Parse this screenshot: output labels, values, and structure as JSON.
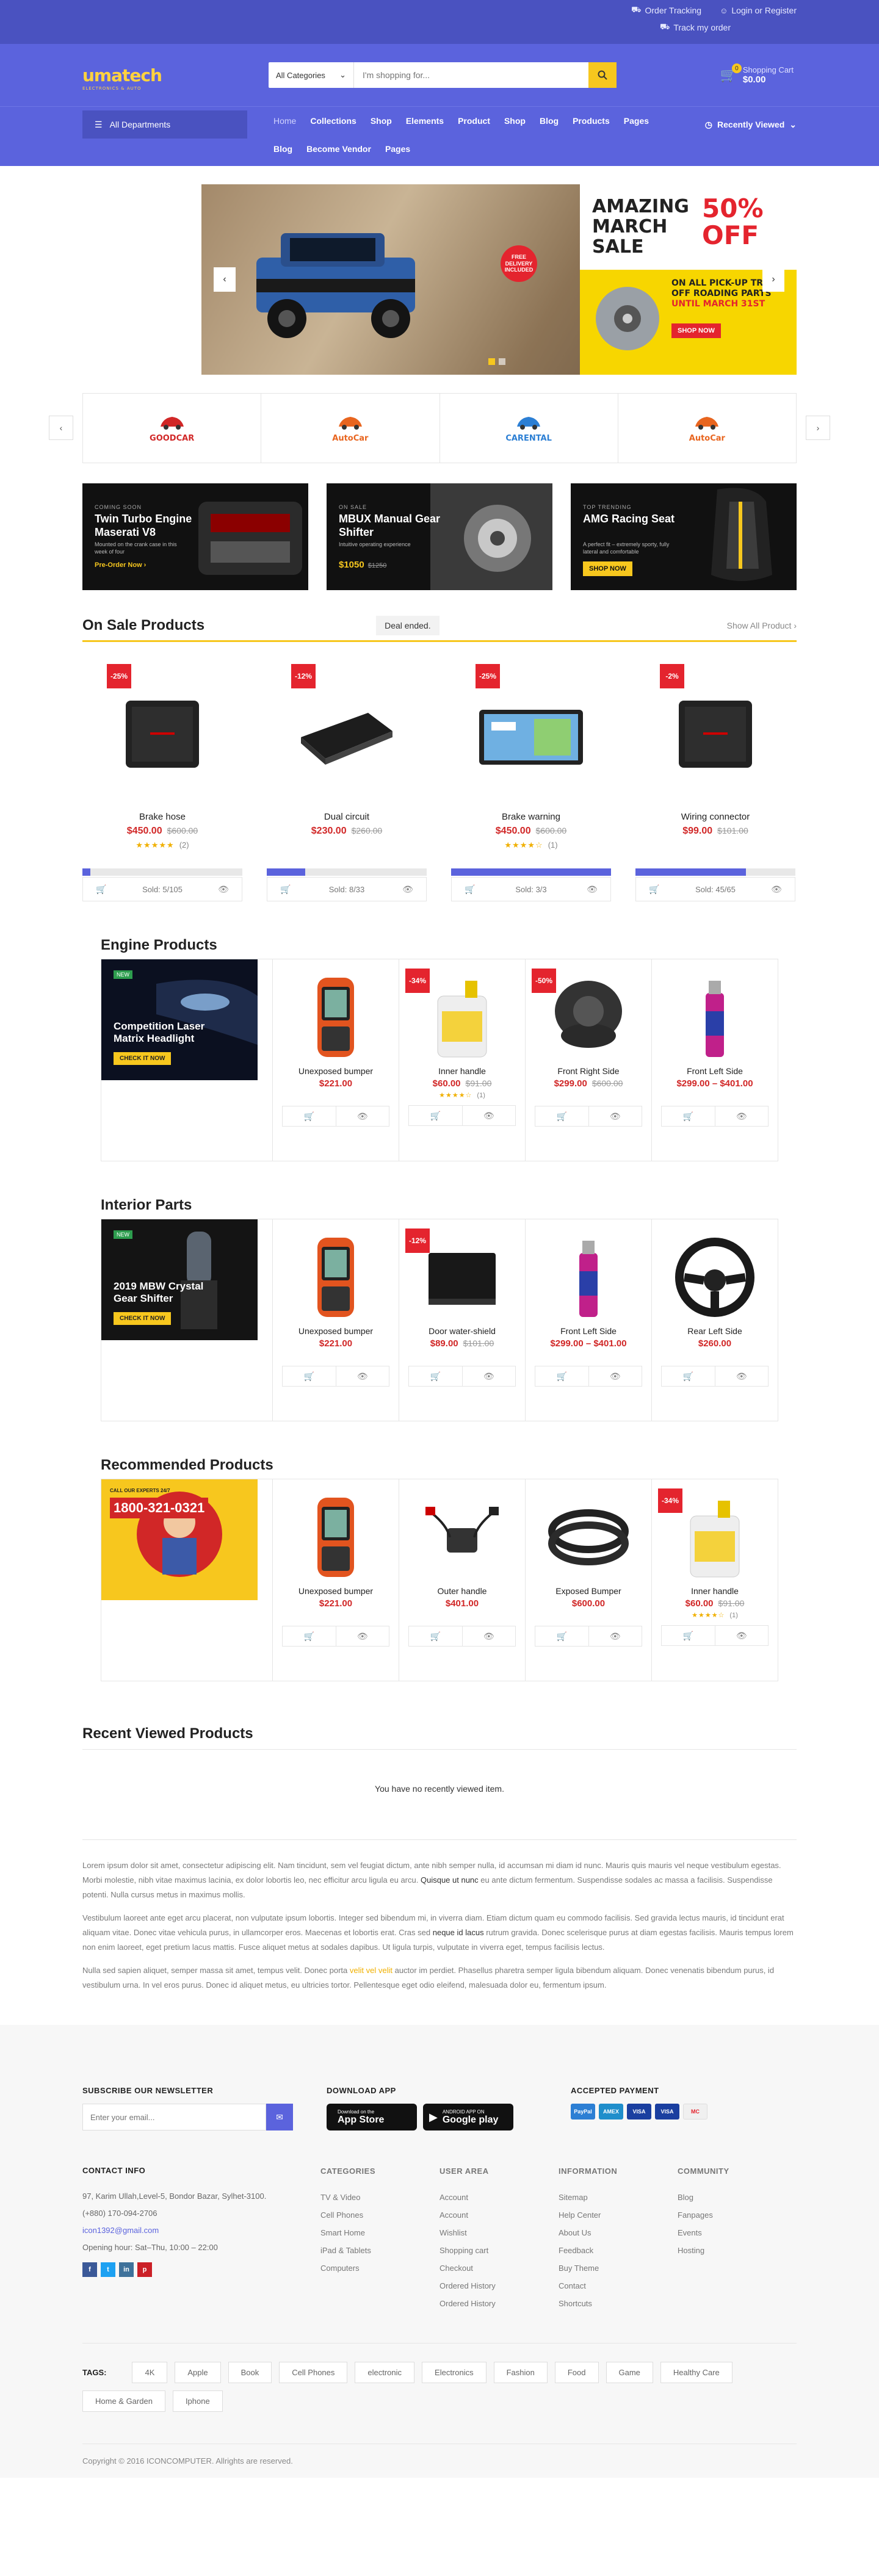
{
  "topbar": {
    "order_tracking": "Order Tracking",
    "login": "Login or Register",
    "track": "Track my order"
  },
  "header": {
    "logo": "umatech",
    "logo_sub": "ELECTRONICS & AUTO",
    "search_category": "All Categories",
    "search_placeholder": "I'm shopping for...",
    "cart_label": "Shopping Cart",
    "cart_total": "$0.00",
    "cart_count": "0"
  },
  "nav": {
    "departments": "All Departments",
    "items": [
      "Home",
      "Collections",
      "Shop",
      "Elements",
      "Product",
      "Shop",
      "Blog",
      "Products",
      "Pages",
      "Blog",
      "Become Vendor",
      "Pages"
    ],
    "recent": "Recently Viewed"
  },
  "hero": {
    "line1": "AMAZING",
    "line2": "MARCH",
    "line3": "SALE",
    "pct": "50%",
    "off": "OFF",
    "sub1": "ON ALL PICK-UP TRUCK",
    "sub2": "OFF ROADING PARTS",
    "sub3": "UNTIL MARCH 31ST",
    "cta": "SHOP NOW",
    "free": "FREE DELIVERY INCLUDED"
  },
  "brands": [
    "GOODCAR",
    "AutoCar",
    "CARENTAL",
    "AutoCar"
  ],
  "brand_colors": [
    "#d12727",
    "#e8651f",
    "#2c7fd4",
    "#e8651f"
  ],
  "promos": [
    {
      "label": "COMING SOON",
      "title": "Twin Turbo Engine Maserati V8",
      "desc": "Mounted on the crank case in this week of four",
      "cta": "Pre-Order Now ›"
    },
    {
      "label": "ON SALE",
      "title": "MBUX Manual Gear Shifter",
      "desc": "Intuitive operating experience",
      "price": "$1050",
      "old": "$1250"
    },
    {
      "label": "TOP TRENDING",
      "title": "AMG Racing Seat",
      "desc": "A perfect fit – extremely sporty, fully lateral and comfortable",
      "cta": "SHOP NOW"
    }
  ],
  "on_sale": {
    "title": "On Sale Products",
    "deal": "Deal ended.",
    "show_all": "Show All Product ›",
    "products": [
      {
        "disc": "-25%",
        "name": "Brake hose",
        "price": "$450.00",
        "old": "$600.00",
        "stars": "★★★★★",
        "count": "(2)",
        "sold": "Sold: 5/105",
        "progress": 0.05
      },
      {
        "disc": "-12%",
        "name": "Dual circuit",
        "price": "$230.00",
        "old": "$260.00",
        "sold": "Sold: 8/33",
        "progress": 0.24
      },
      {
        "disc": "-25%",
        "name": "Brake warning",
        "price": "$450.00",
        "old": "$600.00",
        "stars": "★★★★☆",
        "count": "(1)",
        "sold": "Sold: 3/3",
        "progress": 1.0
      },
      {
        "disc": "-2%",
        "name": "Wiring connector",
        "price": "$99.00",
        "old": "$101.00",
        "sold": "Sold: 45/65",
        "progress": 0.69
      }
    ]
  },
  "sections": [
    {
      "title": "Engine Products",
      "banner": "Competition Laser Matrix Headlight",
      "banner_btn": "CHECK IT NOW",
      "banner_new": "NEW",
      "products": [
        {
          "name": "Unexposed bumper",
          "price": "$221.00"
        },
        {
          "disc": "-34%",
          "name": "Inner handle",
          "price": "$60.00",
          "old": "$91.00",
          "stars": "★★★★☆",
          "count": "(1)"
        },
        {
          "disc": "-50%",
          "name": "Front Right Side",
          "price": "$299.00",
          "old": "$600.00"
        },
        {
          "name": "Front Left Side",
          "price": "$299.00 – $401.00"
        }
      ]
    },
    {
      "title": "Interior Parts",
      "banner": "2019 MBW Crystal Gear Shifter",
      "banner_btn": "CHECK IT NOW",
      "banner_new": "NEW",
      "products": [
        {
          "name": "Unexposed bumper",
          "price": "$221.00"
        },
        {
          "disc": "-12%",
          "name": "Door water-shield",
          "price": "$89.00",
          "old": "$101.00"
        },
        {
          "name": "Front Left Side",
          "price": "$299.00 – $401.00"
        },
        {
          "name": "Rear Left Side",
          "price": "$260.00"
        }
      ]
    },
    {
      "title": "Recommended Products",
      "banner": "1800-321-0321",
      "banner_btn": "",
      "banner_new": "CALL OUR EXPERTS 24/7",
      "products": [
        {
          "name": "Unexposed bumper",
          "price": "$221.00"
        },
        {
          "name": "Outer handle",
          "price": "$401.00"
        },
        {
          "name": "Exposed Bumper",
          "price": "$600.00"
        },
        {
          "disc": "-34%",
          "name": "Inner handle",
          "price": "$60.00",
          "old": "$91.00",
          "stars": "★★★★☆",
          "count": "(1)"
        }
      ]
    }
  ],
  "recent_viewed": {
    "title": "Recent Viewed Products",
    "empty": "You have no recently viewed item."
  },
  "seo": {
    "p1a": "Lorem ipsum dolor sit amet, consectetur adipiscing elit. Nam tincidunt, sem vel feugiat dictum, ante nibh semper nulla, id accumsan mi diam id nunc. Mauris quis mauris vel neque vestibulum egestas. Morbi molestie, nibh vitae maximus lacinia, ex dolor lobortis leo, nec efficitur arcu ligula eu arcu.",
    "p1b": "Quisque ut nunc",
    "p1c": "eu ante dictum fermentum. Suspendisse sodales ac massa a facilisis. Suspendisse potenti. Nulla cursus metus in maximus mollis.",
    "p2a": "Vestibulum laoreet ante eget arcu placerat, non vulputate ipsum lobortis. Integer sed bibendum mi, in viverra diam. Etiam dictum quam eu commodo facilisis. Sed gravida lectus mauris, id tincidunt erat aliquam vitae. Donec vitae vehicula purus, in ullamcorper eros. Maecenas et lobortis erat. Cras sed",
    "p2b": "neque id lacus",
    "p2c": "rutrum gravida. Donec scelerisque purus at diam egestas facilisis. Mauris tempus lorem non enim laoreet, eget pretium lacus mattis. Fusce aliquet metus at sodales dapibus. Ut ligula turpis, vulputate in viverra eget, tempus facilisis lectus.",
    "p3a": "Nulla sed sapien aliquet, semper massa sit amet, tempus velit. Donec porta",
    "p3b": "velit vel velit",
    "p3c": "auctor im perdiet. Phasellus pharetra semper ligula bibendum aliquam. Donec venenatis bibendum purus, id vestibulum urna. In vel eros purus. Donec id aliquet metus, eu ultricies tortor. Pellentesque eget odio eleifend, malesuada dolor eu, fermentum ipsum."
  },
  "footer": {
    "newsletter_title": "SUBSCRIBE OUR NEWSLETTER",
    "newsletter_placeholder": "Enter your email...",
    "app_title": "DOWNLOAD APP",
    "appstore_small": "Download on the",
    "appstore": "App Store",
    "gplay_small": "ANDROID APP ON",
    "gplay": "Google play",
    "payment_title": "ACCEPTED PAYMENT",
    "payments": [
      "PayPal",
      "AMEX",
      "VISA",
      "VISA",
      "MC"
    ],
    "contact_title": "CONTACT INFO",
    "address": "97, Karim Ullah,Level-5, Bondor Bazar, Sylhet-3100.",
    "phone": "(+880) 170-094-2706",
    "email": "icon1392@gmail.com",
    "hours": "Opening hour: Sat–Thu, 10:00 – 22:00",
    "social": [
      "f",
      "t",
      "in",
      "p"
    ],
    "categories_title": "CATEGORIES",
    "categories": [
      "TV & Video",
      "Cell Phones",
      "Smart Home",
      "iPad & Tablets",
      "Computers"
    ],
    "user_title": "USER AREA",
    "user": [
      "Account",
      "Account",
      "Wishlist",
      "Shopping cart",
      "Checkout",
      "Ordered History",
      "Ordered History"
    ],
    "info_title": "INFORMATION",
    "info": [
      "Sitemap",
      "Help Center",
      "About Us",
      "Feedback",
      "Buy Theme",
      "Contact",
      "Shortcuts"
    ],
    "community_title": "COMMUNITY",
    "community": [
      "Blog",
      "Fanpages",
      "Events",
      "Hosting"
    ],
    "tags_title": "TAGS:",
    "tags": [
      "4K",
      "Apple",
      "Book",
      "Cell Phones",
      "electronic",
      "Electronics",
      "Fashion",
      "Food",
      "Game",
      "Healthy Care",
      "Home & Garden",
      "Iphone"
    ],
    "copyright": "Copyright © 2016 ICONCOMPUTER. Allrights are reserved."
  }
}
